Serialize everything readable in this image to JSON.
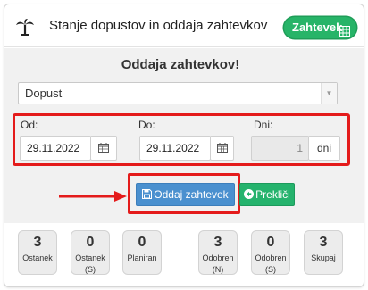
{
  "header": {
    "title": "Stanje dopustov in oddaja zahtevkov",
    "badge_label": "Zahtevek",
    "icon": "palm-tree-icon",
    "badge_icon": "table-icon"
  },
  "form": {
    "title": "Oddaja zahtevkov!",
    "type_select": {
      "value": "Dopust"
    },
    "from": {
      "label": "Od:",
      "value": "29.11.2022"
    },
    "to": {
      "label": "Do:",
      "value": "29.11.2022"
    },
    "days": {
      "label": "Dni:",
      "value": "1",
      "unit": "dni"
    },
    "submit_label": "Oddaj zahtevek",
    "cancel_label": "Prekliči"
  },
  "stats": [
    {
      "value": "3",
      "label": "Ostanek",
      "sub": ""
    },
    {
      "value": "0",
      "label": "Ostanek",
      "sub": "(S)"
    },
    {
      "value": "0",
      "label": "Planiran",
      "sub": ""
    },
    {
      "value": "3",
      "label": "Odobren",
      "sub": "(N)"
    },
    {
      "value": "0",
      "label": "Odobren",
      "sub": "(S)"
    },
    {
      "value": "3",
      "label": "Skupaj",
      "sub": ""
    }
  ],
  "colors": {
    "highlight": "#e41b1b",
    "primary": "#4a90cf",
    "success": "#25b36d",
    "badge": "#27b468"
  }
}
